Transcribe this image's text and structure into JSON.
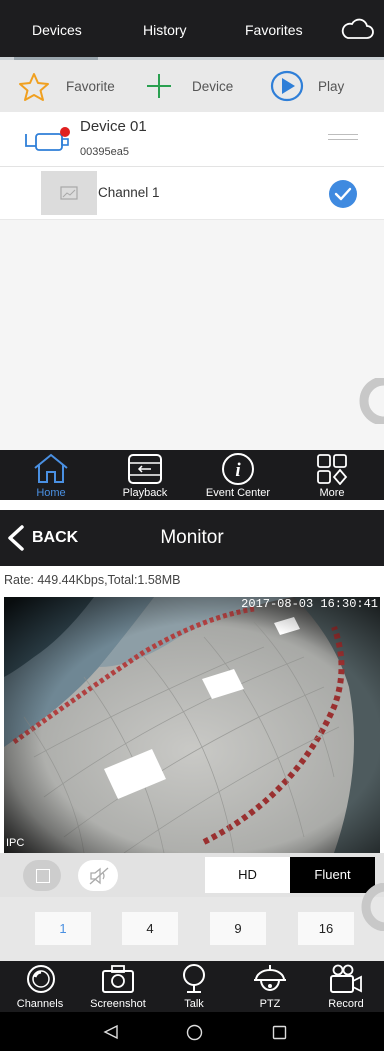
{
  "top_tabs": [
    "Devices",
    "History",
    "Favorites"
  ],
  "toolbar": {
    "favorite_label": "Favorite",
    "device_label": "Device",
    "play_label": "Play"
  },
  "device": {
    "name": "Device 01",
    "id": "00395ea5"
  },
  "channel": {
    "name": "Channel 1",
    "selected": true
  },
  "bottom_nav": {
    "home": "Home",
    "playback": "Playback",
    "event_center": "Event Center",
    "more": "More"
  },
  "monitor": {
    "back_label": "BACK",
    "title": "Monitor",
    "rate_text": "Rate: 449.44Kbps,Total:1.58MB",
    "timestamp": "2017-08-03 16:30:41",
    "camera_label": "IPC",
    "quality_options": [
      "HD",
      "Fluent"
    ],
    "quality_selected": "Fluent",
    "splits": [
      "1",
      "4",
      "9",
      "16"
    ],
    "split_selected": "1"
  },
  "monitor_nav": {
    "channels": "Channels",
    "screenshot": "Screenshot",
    "talk": "Talk",
    "ptz": "PTZ",
    "record": "Record"
  },
  "colors": {
    "accent_blue": "#2f7fd8",
    "active_nav": "#4a90e2",
    "dark_bar": "#1d1d1f"
  }
}
